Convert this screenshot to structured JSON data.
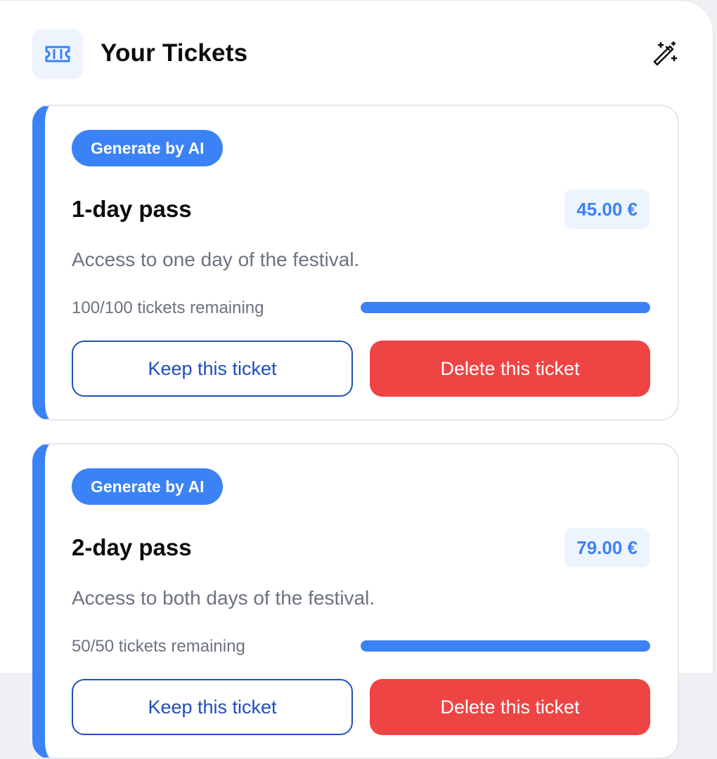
{
  "header": {
    "title": "Your Tickets",
    "ticket_icon": "ticket-icon",
    "action_icon": "magic-wand-icon"
  },
  "colors": {
    "accent": "#3b82f6",
    "danger": "#ef4444",
    "keep_border": "#1e4fb8"
  },
  "tickets": [
    {
      "badge": "Generate by AI",
      "name": "1-day pass",
      "price": "45.00 €",
      "description": "Access to one day of the festival.",
      "remaining": "100/100 tickets remaining",
      "fill_fraction": 1.0,
      "keep_label": "Keep this ticket",
      "delete_label": "Delete this ticket"
    },
    {
      "badge": "Generate by AI",
      "name": "2-day pass",
      "price": "79.00 €",
      "description": "Access to both days of the festival.",
      "remaining": "50/50 tickets remaining",
      "fill_fraction": 1.0,
      "keep_label": "Keep this ticket",
      "delete_label": "Delete this ticket"
    }
  ]
}
